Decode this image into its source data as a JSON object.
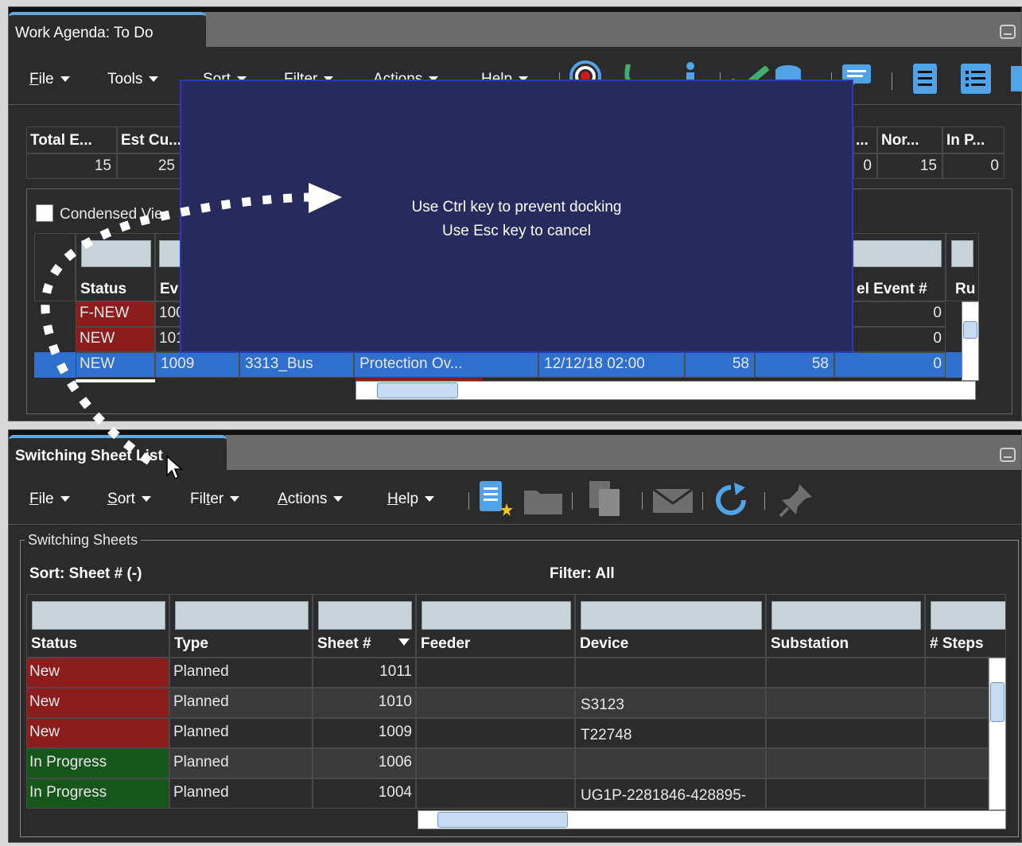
{
  "top_panel": {
    "tab_title": "Work Agenda: To Do",
    "menus": [
      "File",
      "Tools",
      "Sort",
      "Filter",
      "Actions",
      "Help"
    ],
    "summary": {
      "headers": [
        "Total E...",
        "Est Cu...",
        "...",
        "Nor...",
        "In P..."
      ],
      "values": [
        "15",
        "25",
        "0",
        "15",
        "0"
      ]
    },
    "condensed_view_label": "Condensed Vie",
    "columns": [
      "Status",
      "Ev",
      "el Event #",
      "Ru"
    ],
    "rows": [
      {
        "status": "F-NEW",
        "event": "100",
        "feeder": "",
        "device": "",
        "time": "",
        "c1": "",
        "c2": "",
        "rel": "0"
      },
      {
        "status": "NEW",
        "event": "101",
        "feeder": "",
        "device": "",
        "time": "",
        "c1": "",
        "c2": "",
        "rel": "0"
      },
      {
        "status": "NEW",
        "event": "1009",
        "feeder": "3313_Bus",
        "device": "Protection Ov...",
        "time": "12/12/18 02:00",
        "c1": "58",
        "c2": "58",
        "rel": "0"
      }
    ]
  },
  "docking_overlay": {
    "line1": "Use Ctrl key to prevent docking",
    "line2": "Use Esc key to cancel"
  },
  "bottom_panel": {
    "tab_title": "Switching Sheet List",
    "menus": [
      "File",
      "Sort",
      "Filter",
      "Actions",
      "Help"
    ],
    "group_title": "Switching Sheets",
    "sort_label": "Sort: Sheet # (-)",
    "filter_label": "Filter: All",
    "columns": [
      "Status",
      "Type",
      "Sheet #",
      "Feeder",
      "Device",
      "Substation",
      "# Steps"
    ],
    "rows": [
      {
        "status": "New",
        "type": "Planned",
        "sheet": "1011",
        "feeder": "",
        "device": "",
        "substation": ""
      },
      {
        "status": "New",
        "type": "Planned",
        "sheet": "1010",
        "feeder": "",
        "device": "S3123",
        "substation": ""
      },
      {
        "status": "New",
        "type": "Planned",
        "sheet": "1009",
        "feeder": "",
        "device": "T22748",
        "substation": ""
      },
      {
        "status": "In Progress",
        "type": "Planned",
        "sheet": "1006",
        "feeder": "",
        "device": "",
        "substation": ""
      },
      {
        "status": "In Progress",
        "type": "Planned",
        "sheet": "1004",
        "feeder": "",
        "device": "UG1P-2281846-428895-",
        "substation": ""
      }
    ]
  },
  "colors": {
    "panel_bg": "#2b2b2b",
    "tab_accent": "#5fa9e0",
    "overlay_bg": "#262a5c",
    "status_new": "#8b1d1d",
    "status_in_progress": "#17561a",
    "selection": "#2f6fce"
  },
  "icons": [
    "target-icon",
    "phone-icon",
    "info-icon",
    "check-icon",
    "database-icon",
    "comment-icon",
    "document-icon",
    "list-icon",
    "new-sheet-icon",
    "folder-icon",
    "copy-icon",
    "mail-icon",
    "refresh-icon",
    "pin-icon"
  ]
}
